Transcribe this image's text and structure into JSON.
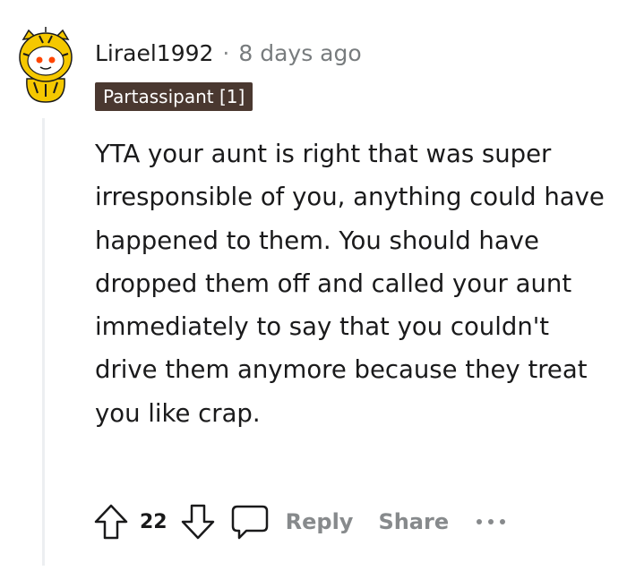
{
  "comment": {
    "username": "Lirael1992",
    "separator": "·",
    "timestamp": "8 days ago",
    "flair": "Partassipant [1]",
    "body": "YTA your aunt is right that was super irresponsible of you, anything could have happened to them. You should have dropped them off and called your aunt immediately to say that you couldn't drive them anymore because they treat you like crap.",
    "avatar_icon": "snoo-tiger-costume-avatar"
  },
  "actions": {
    "upvote_icon": "arrow-up-icon",
    "vote_count": "22",
    "downvote_icon": "arrow-down-icon",
    "comment_icon": "speech-bubble-icon",
    "reply_label": "Reply",
    "share_label": "Share",
    "more_icon": "more-dots-icon"
  },
  "colors": {
    "flair_bg": "#4a3830",
    "action_gray": "#878a8c",
    "thread_line": "#edeff1",
    "avatar_yellow": "#f5c800"
  }
}
